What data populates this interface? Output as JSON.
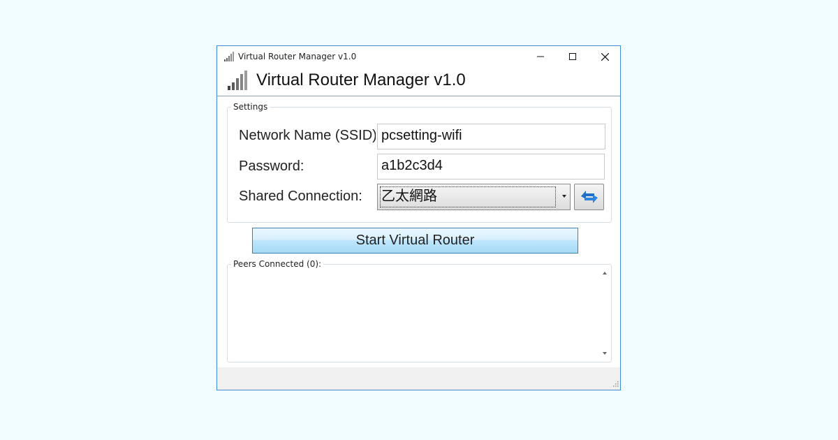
{
  "window": {
    "title": "Virtual Router Manager v1.0",
    "controls": {
      "minimize": "minimize-icon",
      "maximize": "maximize-icon",
      "close": "close-icon"
    }
  },
  "header": {
    "title": "Virtual Router Manager v1.0",
    "icon": "signal-bars-icon"
  },
  "settings": {
    "legend": "Settings",
    "ssid_label": "Network Name (SSID):",
    "ssid_value": "pcsetting-wifi",
    "password_label": "Password:",
    "password_value": "a1b2c3d4",
    "shared_label": "Shared Connection:",
    "shared_value": "乙太網路",
    "refresh_icon": "refresh-arrows-icon"
  },
  "actions": {
    "start_label": "Start Virtual Router"
  },
  "peers": {
    "legend": "Peers Connected (0):"
  },
  "colors": {
    "window_border": "#3c8dd6",
    "background": "#f0fcff",
    "button_blue_top": "#eaf6fd",
    "button_blue_bottom": "#a7d9f5",
    "refresh_icon_blue": "#1f6fc7"
  }
}
